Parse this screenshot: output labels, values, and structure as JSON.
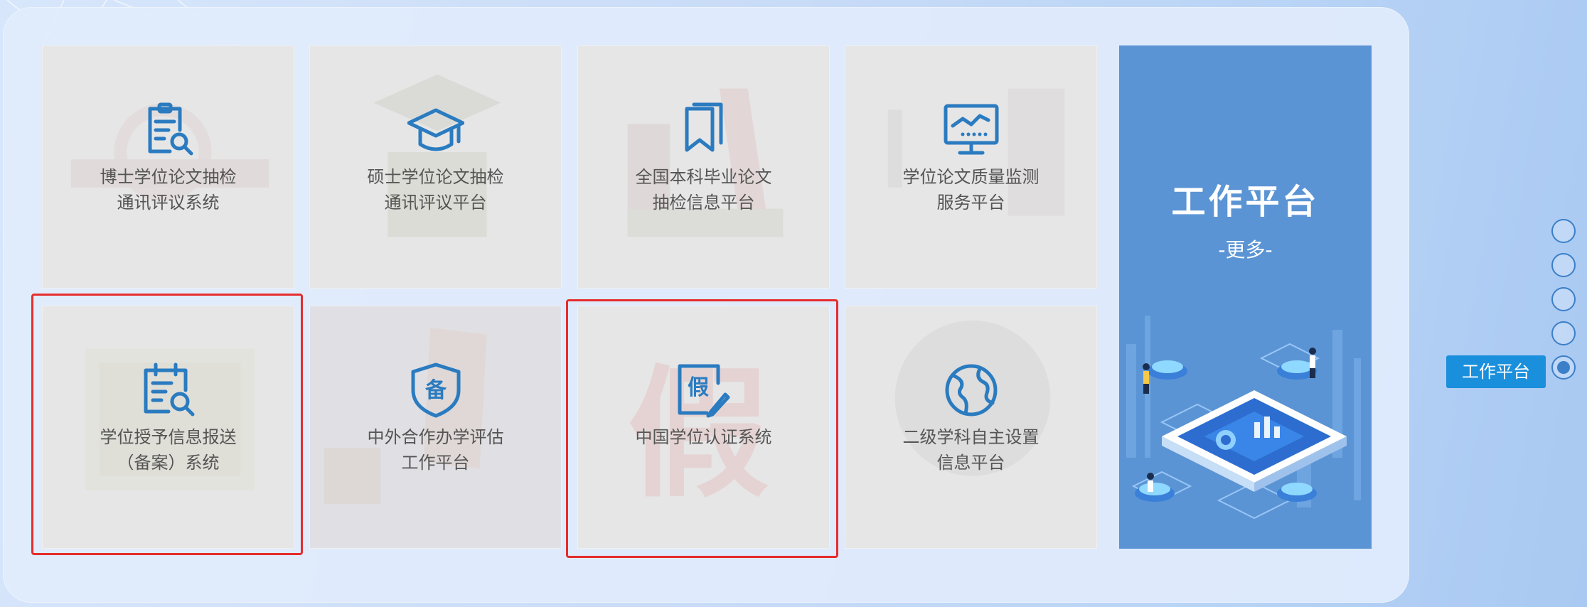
{
  "tiles": [
    {
      "line1": "博士学位论文抽检",
      "line2": "通讯评议系统",
      "icon": "document-search-icon"
    },
    {
      "line1": "硕士学位论文抽检",
      "line2": "通讯评议平台",
      "icon": "graduation-cap-icon"
    },
    {
      "line1": "全国本科毕业论文",
      "line2": "抽检信息平台",
      "icon": "bookmark-icon"
    },
    {
      "line1": "学位论文质量监测",
      "line2": "服务平台",
      "icon": "monitor-chart-icon"
    },
    {
      "line1": "学位授予信息报送",
      "line2": "（备案）系统",
      "icon": "calendar-search-icon"
    },
    {
      "line1": "中外合作办学评估",
      "line2": "工作平台",
      "icon": "shield-badge-icon",
      "badge": "备"
    },
    {
      "line1": "中国学位认证系统",
      "line2": "",
      "icon": "fake-edit-icon",
      "badge": "假"
    },
    {
      "line1": "二级学科自主设置",
      "line2": "信息平台",
      "icon": "globe-icon"
    }
  ],
  "feature": {
    "title": "工作平台",
    "more": "-更多-"
  },
  "side_nav": {
    "active_label": "工作平台",
    "dot_count": 5,
    "active_index": 4
  },
  "colors": {
    "icon": "#2a7bc0",
    "feature_bg": "#5a94d4",
    "highlight": "#e52d2d",
    "tip_bg": "#1a8fdc"
  }
}
